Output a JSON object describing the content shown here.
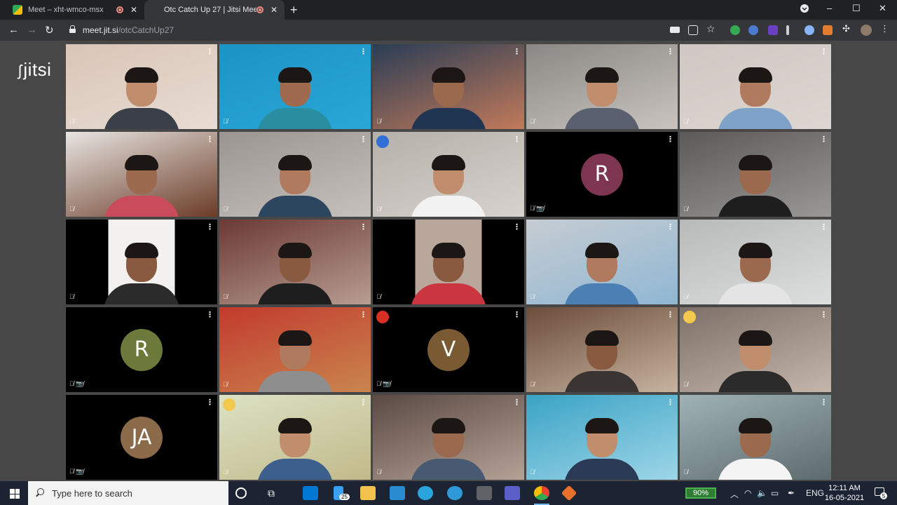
{
  "browser": {
    "tabs": [
      {
        "title": "Meet – xht-wmco-msx",
        "active": false
      },
      {
        "title": "Otc Catch Up 27 | Jitsi Meet",
        "active": true
      }
    ],
    "new_tab": "+",
    "close_glyph": "✕",
    "url_host": "meet.jit.si",
    "url_path": "/otcCatchUp27",
    "window_controls": [
      "–",
      "☐",
      "✕"
    ]
  },
  "logo": {
    "text": "jitsi"
  },
  "participants": [
    {
      "type": "video",
      "bg": [
        "#d9c5b8",
        "#e8dcd2"
      ],
      "skin": "#c08d6d",
      "shirt": "#3a3f4a"
    },
    {
      "type": "video",
      "bg": [
        "#1b94c5",
        "#2aa7d6"
      ],
      "skin": "#a06a4f",
      "shirt": "#2b8ea0"
    },
    {
      "type": "video",
      "bg": [
        "#2a3d55",
        "#c27a5a"
      ],
      "skin": "#9b6a4e",
      "shirt": "#1f3552"
    },
    {
      "type": "video",
      "bg": [
        "#8a8784",
        "#c9c4c0"
      ],
      "skin": "#c08d6d",
      "shirt": "#5a6070"
    },
    {
      "type": "video",
      "bg": [
        "#cfc7c2",
        "#ddd6d1"
      ],
      "skin": "#b07a5e",
      "shirt": "#7fa2c8"
    },
    {
      "type": "video",
      "bg": [
        "#e8e5e2",
        "#6b3c27"
      ],
      "skin": "#9b6a4e",
      "shirt": "#c94b5c"
    },
    {
      "type": "video",
      "bg": [
        "#9a9590",
        "#c6c1bc"
      ],
      "skin": "#b07a5e",
      "shirt": "#2d4660"
    },
    {
      "type": "video",
      "bg": [
        "#b6b0aa",
        "#d7d2cd"
      ],
      "skin": "#c08d6d",
      "shirt": "#f2f2f2",
      "active": true,
      "indicator": {
        "glyph": "📢",
        "color": "#2f6fd6"
      }
    },
    {
      "type": "avatar",
      "initials": "R",
      "color": "#7e3550",
      "video_off": true
    },
    {
      "type": "video",
      "bg": [
        "#5b5a58",
        "#9a9896"
      ],
      "skin": "#9b6a4e",
      "shirt": "#1e1e1e"
    },
    {
      "type": "video",
      "bg": [
        "#000000",
        "#f2f1ef"
      ],
      "skin": "#8a5a40",
      "shirt": "#2b2b2b",
      "pillar": true
    },
    {
      "type": "video",
      "bg": [
        "#6b3a34",
        "#b89d92"
      ],
      "skin": "#8a5a40",
      "shirt": "#1e1e1e"
    },
    {
      "type": "video",
      "bg": [
        "#2c2422",
        "#b9a79c"
      ],
      "skin": "#8a5a40",
      "shirt": "#c9363f",
      "pillar": true
    },
    {
      "type": "video",
      "bg": [
        "#c6ccd2",
        "#8fb7d3"
      ],
      "skin": "#b07a5e",
      "shirt": "#4c7fb3"
    },
    {
      "type": "video",
      "bg": [
        "#b8bab9",
        "#dcdfde"
      ],
      "skin": "#9b6a4e",
      "shirt": "#e4e4e4"
    },
    {
      "type": "avatar",
      "initials": "R",
      "color": "#6b7a3a",
      "video_off": true
    },
    {
      "type": "video",
      "bg": [
        "#c23a2d",
        "#c9864f"
      ],
      "skin": "#b07a5e",
      "shirt": "#8e8e8e"
    },
    {
      "type": "avatar",
      "initials": "V",
      "color": "#7a5a32",
      "video_off": true,
      "indicator": {
        "glyph": "📶",
        "color": "#d93025"
      }
    },
    {
      "type": "video",
      "bg": [
        "#6b4d3a",
        "#c7b3a0"
      ],
      "skin": "#8a5a40",
      "shirt": "#3a3532"
    },
    {
      "type": "video",
      "bg": [
        "#7d7068",
        "#c4b6ab"
      ],
      "skin": "#c08d6d",
      "shirt": "#2b2b2b",
      "indicator": {
        "glyph": "📶",
        "color": "#f2c94c"
      }
    },
    {
      "type": "avatar",
      "initials": "JA",
      "color": "#8a6a48",
      "video_off": true
    },
    {
      "type": "video",
      "bg": [
        "#dbe2c4",
        "#c2b98a"
      ],
      "skin": "#c08d6d",
      "shirt": "#3c5f8c",
      "indicator": {
        "glyph": "📶",
        "color": "#f2c94c"
      }
    },
    {
      "type": "video",
      "bg": [
        "#5a4a44",
        "#b5a196"
      ],
      "skin": "#9b6a4e",
      "shirt": "#475a72"
    },
    {
      "type": "video",
      "bg": [
        "#3aa3c4",
        "#9ed6e8"
      ],
      "skin": "#c08d6d",
      "shirt": "#2b3a55"
    },
    {
      "type": "video",
      "bg": [
        "#9fb2b6",
        "#5d6b6e"
      ],
      "skin": "#9b6a4e",
      "shirt": "#f4f4f4"
    }
  ],
  "taskbar": {
    "search_placeholder": "Type here to search",
    "mail_badge": "25",
    "battery": "90%",
    "lang": "ENG",
    "time": "12:11 AM",
    "date": "16-05-2021",
    "notifications": "5"
  },
  "colors": {
    "accent": "#2f6fd6",
    "page_bg": "#474747",
    "tile_bg": "#000000"
  }
}
